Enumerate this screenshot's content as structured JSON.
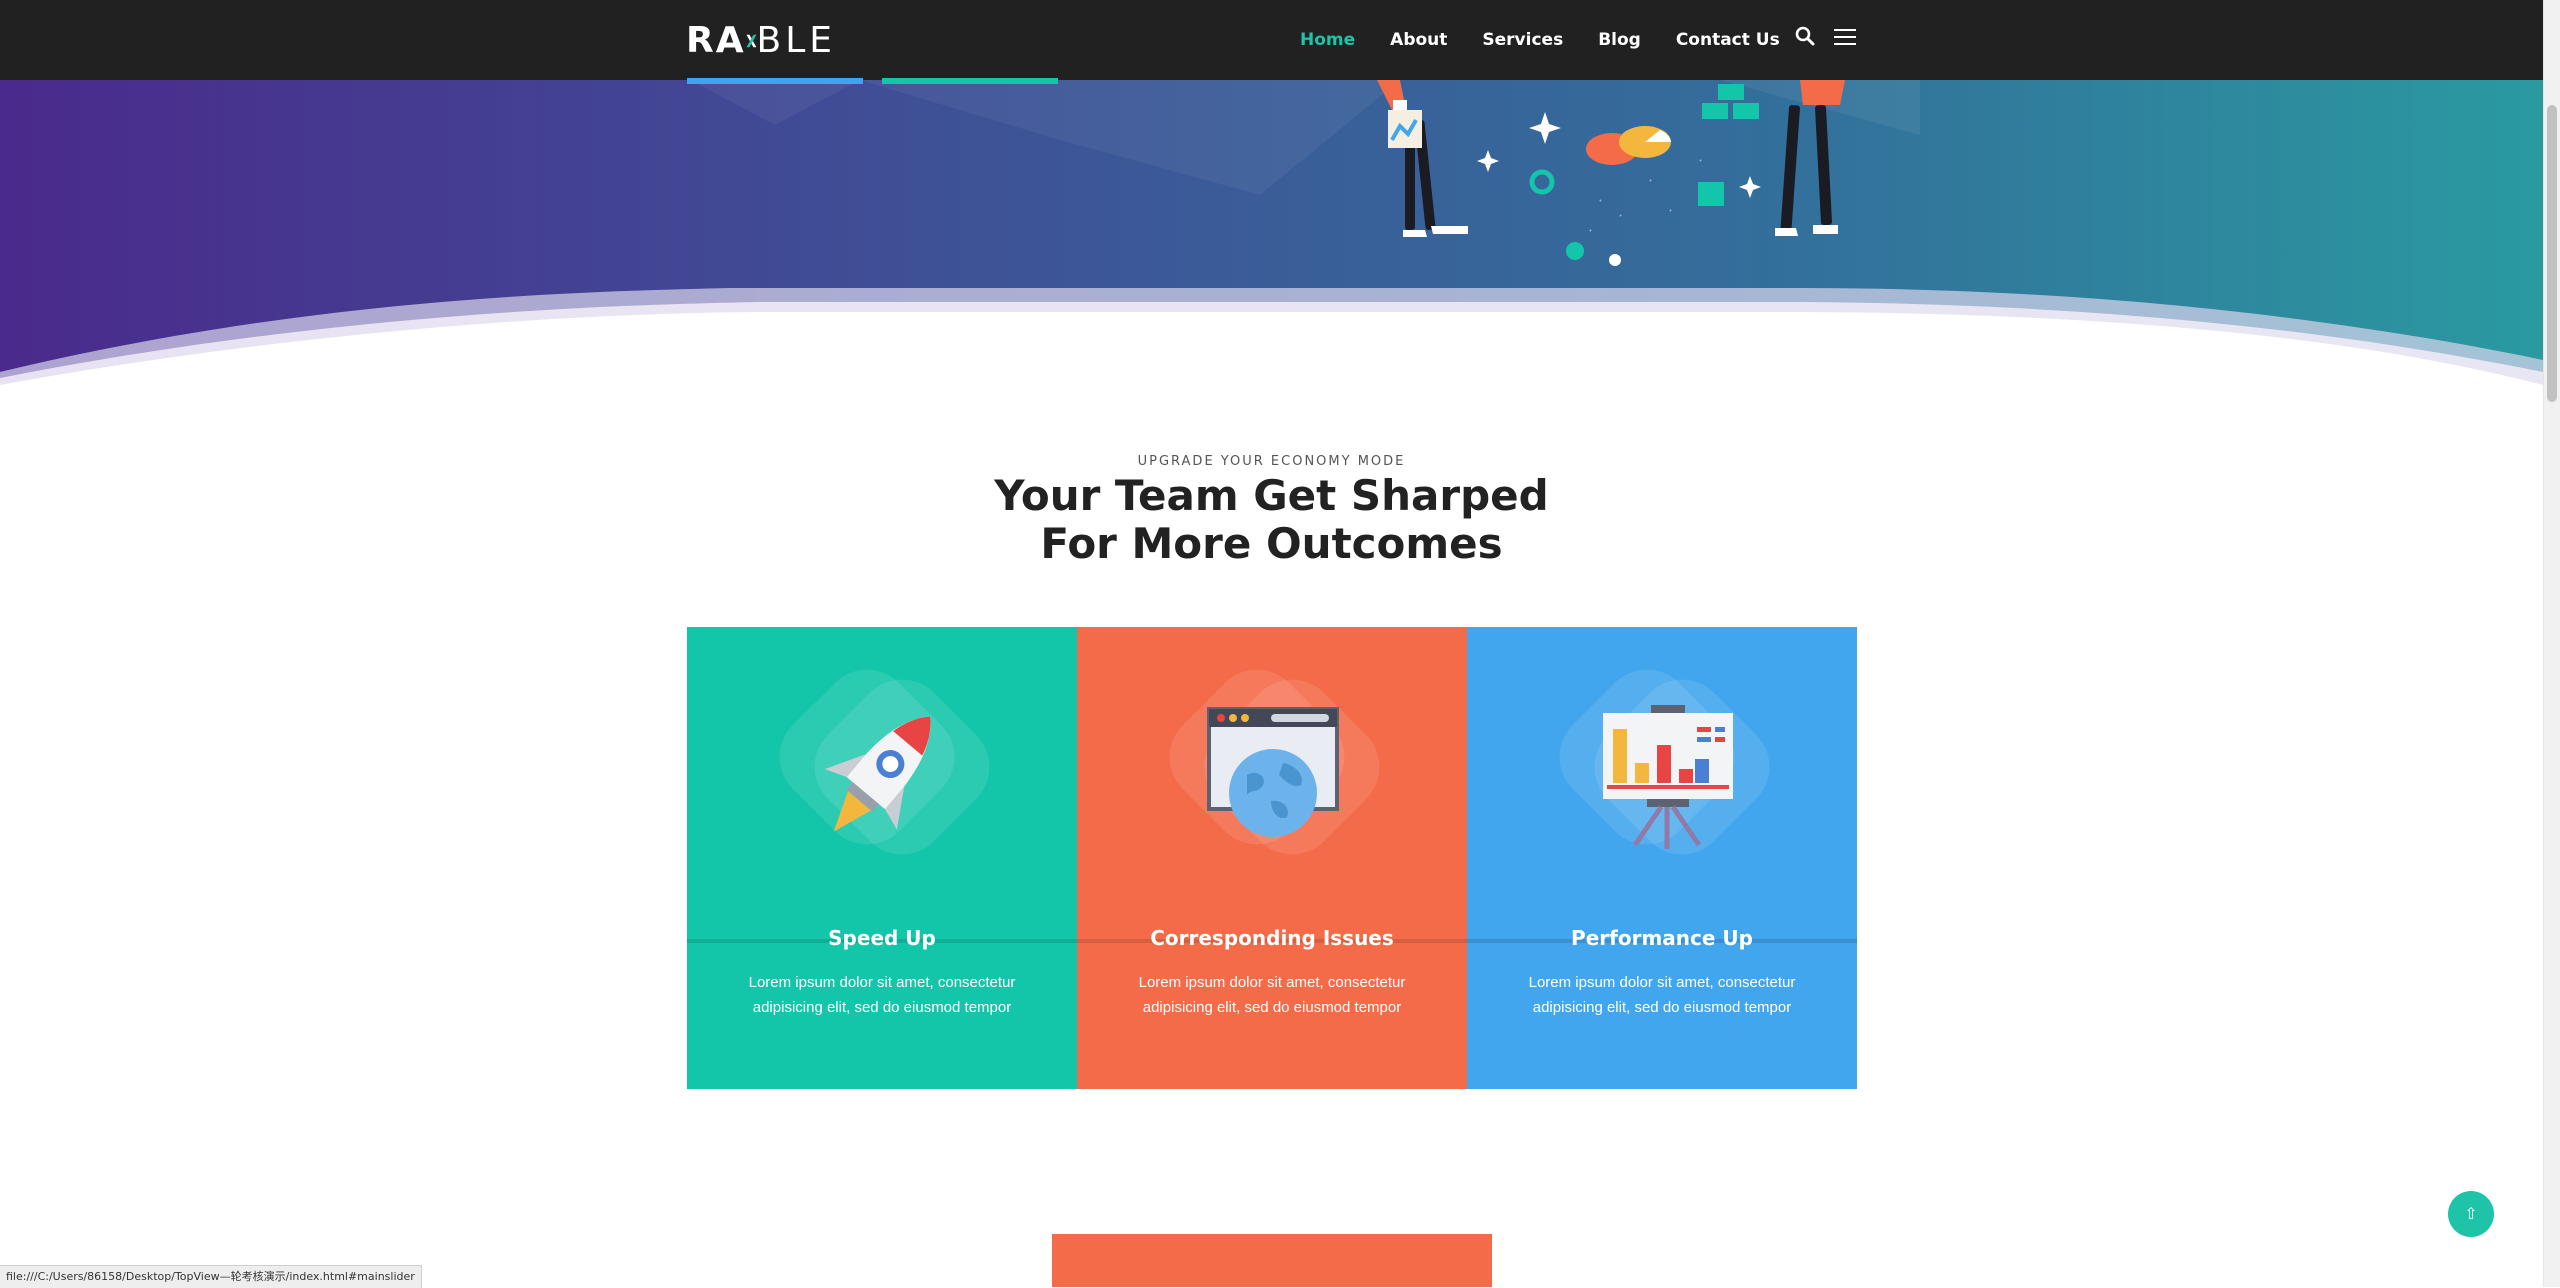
{
  "brand": {
    "logo_left": "RA",
    "logo_right": "BLE"
  },
  "nav": {
    "items": [
      {
        "label": "Home",
        "active": true
      },
      {
        "label": "About",
        "active": false
      },
      {
        "label": "Services",
        "active": false
      },
      {
        "label": "Blog",
        "active": false
      },
      {
        "label": "Contact Us",
        "active": false
      }
    ],
    "icons": [
      "search-icon",
      "hamburger-menu-icon"
    ],
    "accent_color": "#1ec3a8"
  },
  "section": {
    "eyebrow": "UPGRADE YOUR ECONOMY MODE",
    "title_line1": "Your Team Get Sharped",
    "title_line2": "For More Outcomes"
  },
  "cards": [
    {
      "title": "Speed Up",
      "text": "Lorem ipsum dolor sit amet, consectetur adipisicing elit, sed do eiusmod tempor",
      "color": "#13c6a9",
      "icon": "rocket-icon"
    },
    {
      "title": "Corresponding Issues",
      "text": "Lorem ipsum dolor sit amet, consectetur adipisicing elit, sed do eiusmod tempor",
      "color": "#f46b4a",
      "icon": "browser-globe-icon"
    },
    {
      "title": "Performance Up",
      "text": "Lorem ipsum dolor sit amet, consectetur adipisicing elit, sed do eiusmod tempor",
      "color": "#42a6ee",
      "icon": "presentation-chart-icon"
    }
  ],
  "scroll_top": {
    "icon": "arrow-up-icon",
    "glyph": "⇧"
  },
  "status_bar": {
    "url": "file:///C:/Users/86158/Desktop/TopView—轮考核演示/index.html#mainslider"
  }
}
